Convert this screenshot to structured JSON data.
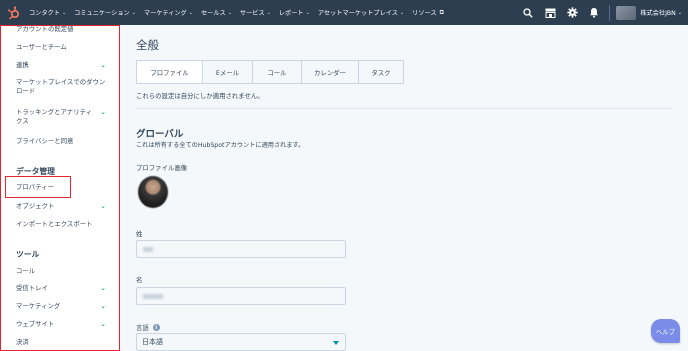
{
  "topnav": {
    "items": [
      {
        "label": "コンタクト"
      },
      {
        "label": "コミュニケーション"
      },
      {
        "label": "マーケティング"
      },
      {
        "label": "セールス"
      },
      {
        "label": "サービス"
      },
      {
        "label": "レポート"
      },
      {
        "label": "アセットマーケットプレイス"
      },
      {
        "label": "リソース"
      }
    ],
    "account_name": "株式会社JBN"
  },
  "sidebar": {
    "items_top": [
      {
        "label": "アカウントの既定値"
      },
      {
        "label": "ユーザーとチーム"
      },
      {
        "label": "連携"
      },
      {
        "label": "マーケットプレイスでのダウンロード"
      },
      {
        "label": "トラッキングとアナリティクス"
      },
      {
        "label": "プライバシーと同意"
      }
    ],
    "data_heading": "データ管理",
    "data_items": [
      {
        "label": "プロパティー"
      },
      {
        "label": "オブジェクト"
      },
      {
        "label": "インポートとエクスポート"
      }
    ],
    "tools_heading": "ツール",
    "tools_items": [
      {
        "label": "コール"
      },
      {
        "label": "受信トレイ"
      },
      {
        "label": "マーケティング"
      },
      {
        "label": "ウェブサイト"
      },
      {
        "label": "決済"
      }
    ]
  },
  "main": {
    "title": "全般",
    "tabs": [
      {
        "label": "プロファイル",
        "active": true
      },
      {
        "label": "Eメール"
      },
      {
        "label": "コール"
      },
      {
        "label": "カレンダー"
      },
      {
        "label": "タスク"
      }
    ],
    "note": "これらの設定は自分にしか適用されません。",
    "section_title": "グローバル",
    "section_desc": "これは所有する全てのHubSpotアカウントに適用されます。",
    "profile_image_label": "プロファイル画像",
    "last_name_label": "姓",
    "first_name_label": "名",
    "language_label": "言語",
    "language_value": "日本語"
  },
  "help_label": "ヘルプ",
  "colors": {
    "nav_bg": "#2d3e50",
    "accent": "#ff7a59",
    "highlight": "#e0262e",
    "link": "#0091ae"
  }
}
